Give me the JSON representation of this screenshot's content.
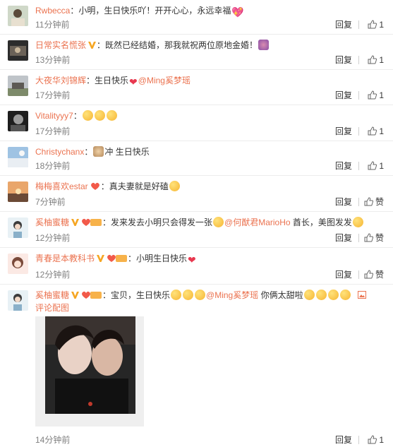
{
  "comments": [
    {
      "user": "Rwbecca",
      "badges": [],
      "text": "：小明，生日快乐吖！开开心心，永远幸福",
      "mention": "",
      "text_after": "",
      "emoji_after": [
        "heart-sparkle"
      ],
      "time": "11分钟前",
      "reply": "回复",
      "like": "1"
    },
    {
      "user": "日常实名慌张",
      "badges": [
        "v-badge"
      ],
      "text": "：既然已经结婚，那我就祝两位原地金婚！",
      "mention": "",
      "text_after": "",
      "emoji_after": [
        "raise-hand"
      ],
      "time": "13分钟前",
      "reply": "回复",
      "like": "1"
    },
    {
      "user": "大夜华刘锦辉",
      "badges": [],
      "text": "：生日快乐",
      "mention": "@Ming奚梦瑶",
      "text_after": "",
      "emoji_after": [],
      "time": "17分钟前",
      "reply": "回复",
      "like": "1"
    },
    {
      "user": "Vitalityyy7",
      "badges": [],
      "text": "：",
      "mention": "",
      "text_after": "",
      "emoji_after": [
        "face",
        "face",
        "face"
      ],
      "time": "17分钟前",
      "reply": "回复",
      "like": "1"
    },
    {
      "user": "Christychanx",
      "badges": [],
      "text": "：",
      "mention": "",
      "text_after": "冲 生日快乐",
      "emoji_after": [],
      "time": "18分钟前",
      "reply": "回复",
      "like": "1"
    },
    {
      "user": "梅梅喜欢estar",
      "badges": [
        "fan-badge"
      ],
      "text": "：真夫妻就是好磕",
      "mention": "",
      "text_after": "",
      "emoji_after": [
        "face"
      ],
      "time": "7分钟前",
      "reply": "回复",
      "like": "赞"
    },
    {
      "user": "奚柚蜜糖",
      "badges": [
        "v-badge",
        "fan-badge"
      ],
      "text": "：发来发去小明只会得发一张",
      "mention": "@何猷君MarioHo",
      "text_after": " 酋长，美图发发",
      "emoji_after": [],
      "time": "12分钟前",
      "reply": "回复",
      "like": "赞"
    },
    {
      "user": "青春是本教科书",
      "badges": [
        "v-badge",
        "fan-badge"
      ],
      "text": "：小明生日快乐",
      "mention": "",
      "text_after": "",
      "emoji_after": [
        "heart"
      ],
      "time": "12分钟前",
      "reply": "回复",
      "like": "赞"
    },
    {
      "user": "奚柚蜜糖",
      "badges": [
        "v-badge",
        "fan-badge"
      ],
      "text": "：宝贝，生日快乐",
      "mention": "@Ming奚梦瑶",
      "text_after": " 你俩太甜啦",
      "emoji_after": [
        "face",
        "face",
        "face",
        "face"
      ],
      "time": "14分钟前",
      "reply": "回复",
      "like": "1",
      "pic_link": "评论配图"
    }
  ]
}
